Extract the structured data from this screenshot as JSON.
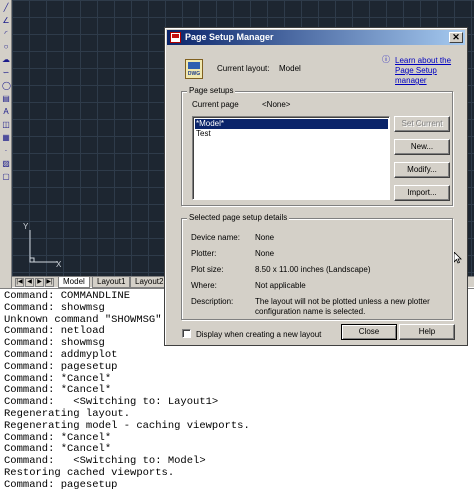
{
  "toolbar": {
    "icons": [
      "line-icon",
      "polyline-icon",
      "arc-icon",
      "circle-icon",
      "revcloud-icon",
      "spline-icon",
      "ellipse-icon",
      "hatch-icon",
      "text-icon",
      "insert-block-icon",
      "table-icon",
      "point-icon",
      "gradient-icon",
      "region-icon"
    ]
  },
  "ucs": {
    "y_label": "Y",
    "x_label": "X"
  },
  "tabs": {
    "items": [
      "Model",
      "Layout1",
      "Layout2"
    ],
    "active": "Model"
  },
  "command_history": [
    "Command: COMMANDLINE",
    "Command: showmsg",
    "Unknown command \"SHOWMSG\".  Pre",
    "Command: netload",
    "Command: showmsg",
    "Command: addmyplot",
    "Command: pagesetup",
    "Command: *Cancel*",
    "Command: *Cancel*",
    "Command:   <Switching to: Layout1>",
    "Regenerating layout.",
    "Regenerating model - caching viewports.",
    "Command: *Cancel*",
    "Command: *Cancel*",
    "Command:   <Switching to: Model>",
    "Restoring cached viewports.",
    "Command: pagesetup"
  ],
  "dialog": {
    "title": "Page Setup Manager",
    "close_glyph": "✕",
    "file_icon_text": "DWG",
    "current_layout_label": "Current layout:",
    "current_layout_value": "Model",
    "help_link": "Learn about the Page Setup manager",
    "page_setups": {
      "legend": "Page setups",
      "current_page_label": "Current page",
      "current_page_value": "<None>",
      "items": [
        "*Model*",
        "Test"
      ],
      "selected_index": 0,
      "buttons": {
        "set_current": "Set Current",
        "new": "New...",
        "modify": "Modify...",
        "import": "Import..."
      }
    },
    "details": {
      "legend": "Selected page setup details",
      "device_name_label": "Device name:",
      "device_name_value": "None",
      "plotter_label": "Plotter:",
      "plotter_value": "None",
      "plot_size_label": "Plot size:",
      "plot_size_value": "8.50 x 11.00 inches (Landscape)",
      "where_label": "Where:",
      "where_value": "Not applicable",
      "description_label": "Description:",
      "description_value": "The layout will not be plotted unless a new plotter configuration name is selected."
    },
    "show_on_new_layout_label": "Display when creating a new layout",
    "show_on_new_layout_checked": false,
    "close_button": "Close",
    "help_button": "Help"
  }
}
